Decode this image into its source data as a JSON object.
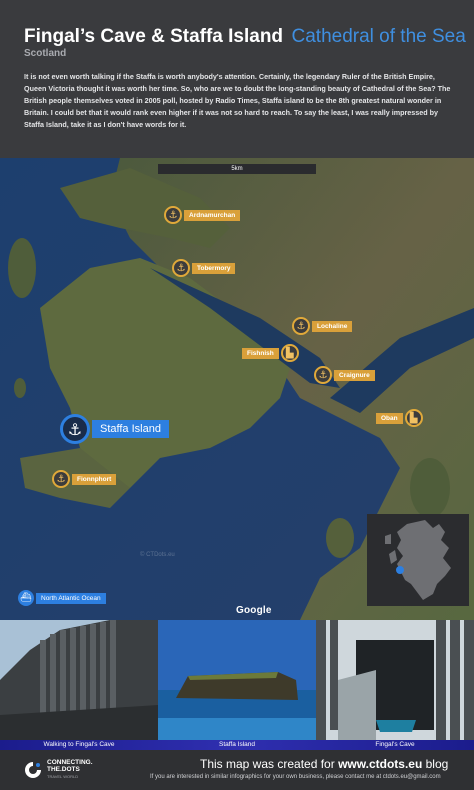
{
  "header": {
    "title": "Fingal’s Cave & Staffa Island",
    "title_accent": "Cathedral of the Sea",
    "subtitle": "Scotland",
    "intro": "It is not even worth talking if the Staffa is worth anybody's attention. Certainly, the legendary Ruler of the British Empire, Queen Victoria thought it was worth her time. So, who are we to doubt the long-standing beauty of Cathedral of the Sea? The British people themselves voted in 2005 poll, hosted by Radio Times, Staffa island to be the 8th greatest natural wonder in Britain. I could bet that it would rank even higher if it was not so hard to reach. To say the least, I was really impressed by Staffa Island, take it as I don't have words for it."
  },
  "map": {
    "scale": "5km",
    "places": [
      {
        "label": "Ardnamurchan",
        "icon": "anchor-icon"
      },
      {
        "label": "Tobermory",
        "icon": "anchor-icon"
      },
      {
        "label": "Lochaline",
        "icon": "anchor-icon"
      },
      {
        "label": "Fishnish",
        "icon": "building-icon"
      },
      {
        "label": "Craignure",
        "icon": "anchor-icon"
      },
      {
        "label": "Oban",
        "icon": "building-icon"
      },
      {
        "label": "Fionnphort",
        "icon": "anchor-icon"
      }
    ],
    "highlight": {
      "label": "Staffa Island",
      "icon": "anchor-icon"
    },
    "ocean": {
      "label": "North Atlantic Ocean",
      "icon": "ship-icon"
    },
    "attribution": "Google",
    "watermark": "© CTDots.eu",
    "colors": {
      "accent_blue": "#2d7fe0",
      "place_gold": "#d9a03a"
    }
  },
  "photos": [
    {
      "caption": "Walking to Fingal's Cave"
    },
    {
      "caption": "Staffa Island"
    },
    {
      "caption": "Fingal's Cave"
    }
  ],
  "footer": {
    "logo_line1": "CONNECTING.",
    "logo_line2": "THE.DOTS",
    "logo_tagline": "TRAVEL WORLD",
    "main_prefix": "This map was created for ",
    "main_site": "www.ctdots.eu",
    "main_suffix": " blog",
    "sub": "If you are interested in similar infographics for your own business, please contact me at ctdots.eu@gmail.com"
  }
}
